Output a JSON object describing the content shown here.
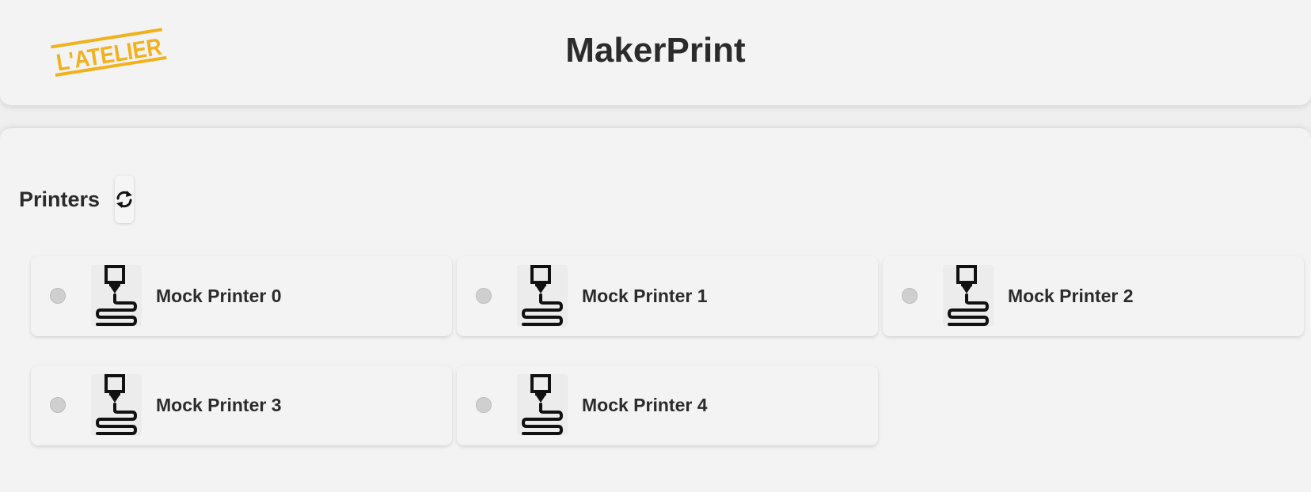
{
  "header": {
    "logo_text": "L'ATELIER",
    "title": "MakerPrint"
  },
  "colors": {
    "logo": "#f2b11b",
    "text": "#2b2b2b",
    "panel": "#f3f3f3",
    "status_offline": "#cfcfcf"
  },
  "printers_section": {
    "title": "Printers",
    "refresh_icon": "refresh-icon"
  },
  "printers": [
    {
      "name": "Mock Printer 0",
      "status": "offline",
      "icon": "3d-printer-icon"
    },
    {
      "name": "Mock Printer 1",
      "status": "offline",
      "icon": "3d-printer-icon"
    },
    {
      "name": "Mock Printer 2",
      "status": "offline",
      "icon": "3d-printer-icon"
    },
    {
      "name": "Mock Printer 3",
      "status": "offline",
      "icon": "3d-printer-icon"
    },
    {
      "name": "Mock Printer 4",
      "status": "offline",
      "icon": "3d-printer-icon"
    }
  ]
}
